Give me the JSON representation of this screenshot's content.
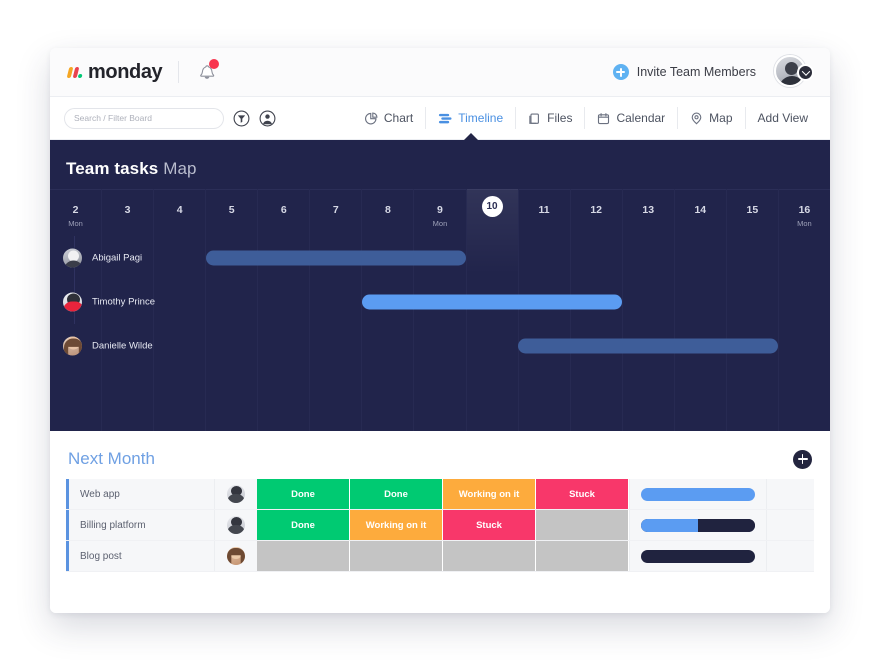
{
  "brand": {
    "name": "monday",
    "accent_orange": "#f5a623",
    "accent_red": "#e8434f",
    "accent_green": "#00c875"
  },
  "topbar": {
    "notification_icon": "bell-icon",
    "has_unread": true,
    "invite_label": "Invite Team Members",
    "invite_icon": "plus-circle-icon",
    "avatar_icon": "user-avatar",
    "avatar_badge_icon": "chevron-down-icon"
  },
  "toolbar": {
    "search_placeholder": "Search / Filter Board",
    "search_value": "",
    "filter_icon": "funnel-icon",
    "person_icon": "person-circle-icon",
    "tabs": [
      {
        "label": "Chart",
        "icon": "pie-chart-icon",
        "active": false
      },
      {
        "label": "Timeline",
        "icon": "timeline-icon",
        "active": true
      },
      {
        "label": "Files",
        "icon": "file-icon",
        "active": false
      },
      {
        "label": "Calendar",
        "icon": "calendar-icon",
        "active": false
      },
      {
        "label": "Map",
        "icon": "map-pin-icon",
        "active": false
      },
      {
        "label": "Add View",
        "icon": "",
        "active": false
      }
    ]
  },
  "board": {
    "title": "Team tasks",
    "subtitle": "Map",
    "background": "#21244b"
  },
  "timeline": {
    "days": [
      {
        "num": "2",
        "dow": "Mon",
        "today": false
      },
      {
        "num": "3",
        "dow": "",
        "today": false
      },
      {
        "num": "4",
        "dow": "",
        "today": false
      },
      {
        "num": "5",
        "dow": "",
        "today": false
      },
      {
        "num": "6",
        "dow": "",
        "today": false
      },
      {
        "num": "7",
        "dow": "",
        "today": false
      },
      {
        "num": "8",
        "dow": "",
        "today": false
      },
      {
        "num": "9",
        "dow": "Mon",
        "today": false
      },
      {
        "num": "10",
        "dow": "",
        "today": true
      },
      {
        "num": "11",
        "dow": "",
        "today": false
      },
      {
        "num": "12",
        "dow": "",
        "today": false
      },
      {
        "num": "13",
        "dow": "",
        "today": false
      },
      {
        "num": "14",
        "dow": "",
        "today": false
      },
      {
        "num": "15",
        "dow": "",
        "today": false
      },
      {
        "num": "16",
        "dow": "Mon",
        "today": false
      }
    ],
    "rows": [
      {
        "name": "Abigail  Pagi",
        "avatar": "avatar-abigail",
        "bar_start_day": 4,
        "bar_end_day": 8,
        "color": "#3e5d99"
      },
      {
        "name": "Timothy Prince",
        "avatar": "avatar-timothy",
        "bar_start_day": 7,
        "bar_end_day": 11,
        "color": "#5b9cf2"
      },
      {
        "name": "Danielle Wilde",
        "avatar": "avatar-danielle",
        "bar_start_day": 10,
        "bar_end_day": 14,
        "color": "#3e5d99"
      }
    ]
  },
  "group": {
    "title": "Next Month",
    "add_icon": "plus-circle-icon",
    "status_colors": {
      "Done": "#00ca72",
      "Working on it": "#fdab3d",
      "Stuck": "#f8376a",
      "": "#c4c4c4"
    },
    "rows": [
      {
        "name": "Web app",
        "avatar": "avatar-person-dark",
        "statuses": [
          "Done",
          "Done",
          "Working on it",
          "Stuck"
        ],
        "progress": 100
      },
      {
        "name": "Billing platform",
        "avatar": "avatar-person-dark",
        "statuses": [
          "Done",
          "Working on it",
          "Stuck",
          ""
        ],
        "progress": 50
      },
      {
        "name": "Blog post",
        "avatar": "avatar-woman",
        "statuses": [
          "",
          "",
          "",
          ""
        ],
        "progress": 0
      }
    ]
  }
}
